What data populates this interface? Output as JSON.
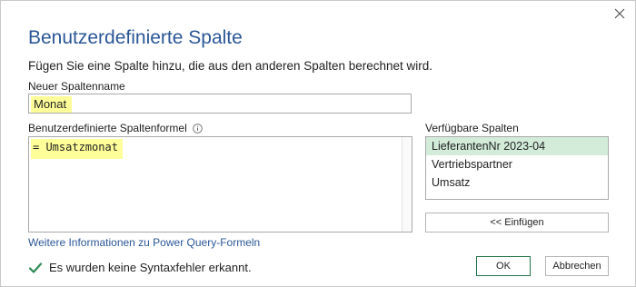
{
  "dialog": {
    "title": "Benutzerdefinierte Spalte",
    "description": "Fügen Sie eine Spalte hinzu, die aus den anderen Spalten berechnet wird."
  },
  "new_column": {
    "label": "Neuer Spaltenname",
    "value": "Monat"
  },
  "formula": {
    "label": "Benutzerdefinierte Spaltenformel",
    "value": "= Umsatzmonat"
  },
  "available_columns": {
    "label": "Verfügbare Spalten",
    "items": [
      {
        "label": "LieferantenNr 2023-04",
        "selected": true
      },
      {
        "label": "Vertriebspartner",
        "selected": false
      },
      {
        "label": "Umsatz",
        "selected": false
      }
    ],
    "insert_label": "<< Einfügen"
  },
  "help_link": "Weitere Informationen zu Power Query-Formeln",
  "status": {
    "text": "Es wurden keine Syntaxfehler erkannt.",
    "icon": "checkmark-icon",
    "color": "#2e8b57"
  },
  "buttons": {
    "ok": "OK",
    "cancel": "Abbrechen"
  },
  "colors": {
    "title": "#2b5797",
    "highlight": "#ffff99",
    "selected_item": "#d2ecd9",
    "ok_border": "#217346"
  }
}
